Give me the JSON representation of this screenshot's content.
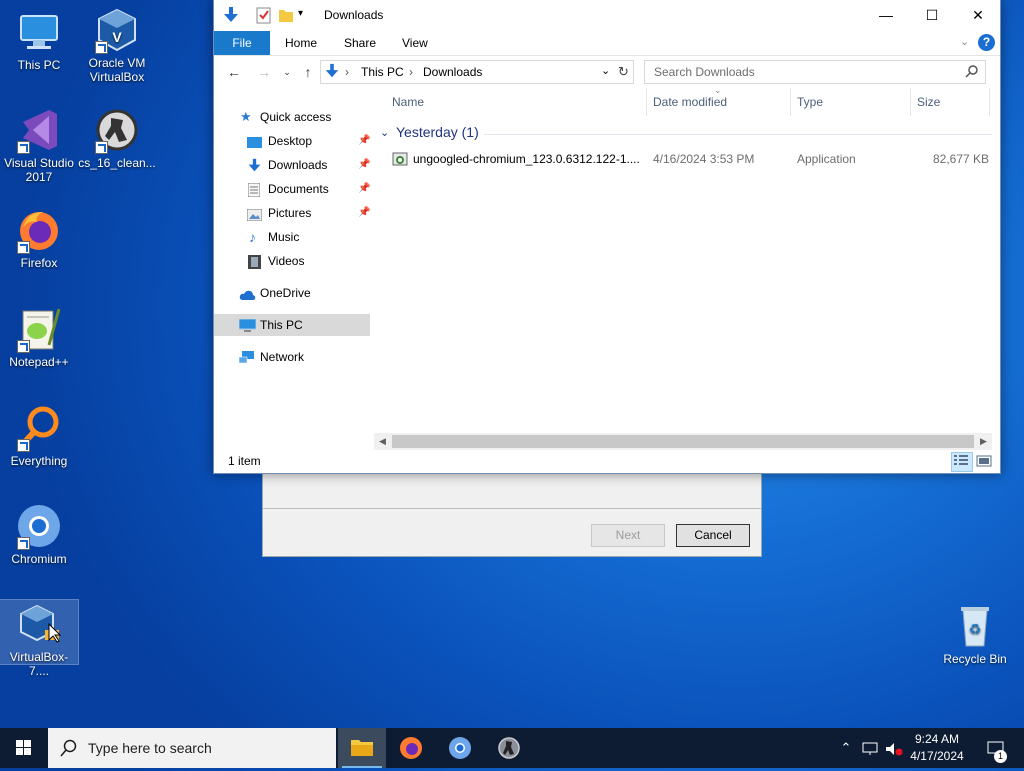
{
  "desktop": {
    "icons": [
      {
        "label": "This PC",
        "line2": ""
      },
      {
        "label": "Oracle VM",
        "line2": "VirtualBox"
      },
      {
        "label": "Visual Studio",
        "line2": "2017"
      },
      {
        "label": "cs_16_clean...",
        "line2": ""
      },
      {
        "label": "Firefox",
        "line2": ""
      },
      {
        "label": "Notepad++",
        "line2": ""
      },
      {
        "label": "Everything",
        "line2": ""
      },
      {
        "label": "Chromium",
        "line2": ""
      },
      {
        "label": "VirtualBox-7....",
        "line2": ""
      },
      {
        "label": "Recycle Bin",
        "line2": ""
      }
    ]
  },
  "setup_dialog": {
    "next_label": "Next",
    "cancel_label": "Cancel"
  },
  "explorer": {
    "title": "Downloads",
    "tabs": [
      "File",
      "Home",
      "Share",
      "View"
    ],
    "breadcrumb": [
      "This PC",
      "Downloads"
    ],
    "search_placeholder": "Search Downloads",
    "nav": {
      "quick_access": "Quick access",
      "desktop": "Desktop",
      "downloads": "Downloads",
      "documents": "Documents",
      "pictures": "Pictures",
      "music": "Music",
      "videos": "Videos",
      "onedrive": "OneDrive",
      "this_pc": "This PC",
      "network": "Network"
    },
    "columns": {
      "name": "Name",
      "date": "Date modified",
      "type": "Type",
      "size": "Size"
    },
    "group": "Yesterday (1)",
    "file": {
      "name": "ungoogled-chromium_123.0.6312.122-1....",
      "date": "4/16/2024 3:53 PM",
      "type": "Application",
      "size": "82,677 KB"
    },
    "status": "1 item"
  },
  "taskbar": {
    "search_placeholder": "Type here to search",
    "time": "9:24 AM",
    "date": "4/17/2024",
    "notification_count": "1"
  },
  "colors": {
    "accent": "#1979ca",
    "taskbar": "#0e1c33",
    "group_header": "#1e3287"
  }
}
